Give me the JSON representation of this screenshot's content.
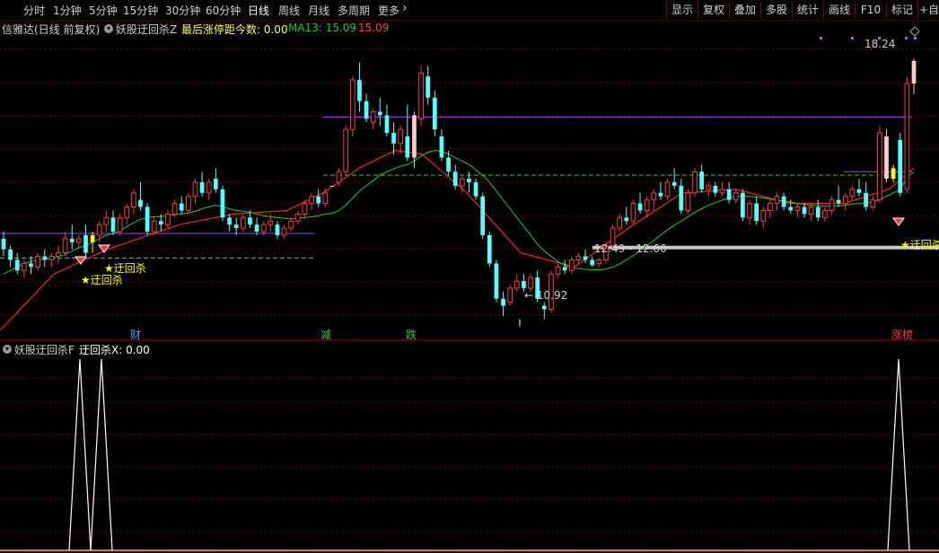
{
  "toolbar": {
    "periods": [
      "分时",
      "1分钟",
      "5分钟",
      "15分钟",
      "30分钟",
      "60分钟",
      "日线",
      "周线",
      "月线",
      "多周期",
      "更多"
    ],
    "active_period": "日线",
    "more_arrow": "›",
    "buttons": [
      "显示",
      "复权",
      "叠加",
      "多股",
      "统计",
      "画线",
      "F10",
      "标记",
      "+自选"
    ]
  },
  "main_panel": {
    "stock_label": "信雅达(日线 前复权)",
    "indicator_name": "妖股迂回杀Z",
    "stat_label": "最后涨停距今数: 0.00",
    "ma_label": "MA13: 15.09",
    "ma_value2": "15.09",
    "price_high_label": "18.24",
    "price_low_label": "10.92",
    "range_label": "12.49 - 12.66",
    "signal_texts": [
      "迂回杀",
      "迂回杀",
      "迂回杀"
    ],
    "bottom_markers": [
      "财",
      "减",
      "跌",
      "涨榜"
    ]
  },
  "sub_panel": {
    "indicator_name": "妖股迂回杀F",
    "value_label": "迂回杀X: 0.00"
  },
  "colors": {
    "up": "#ff3b3b",
    "down": "#54ffff",
    "ma13": "#22cc22",
    "trend": "#ff2020",
    "support": "#ffff00",
    "grid": "#8b0000",
    "purple": "#9b40ff",
    "green_dash": "#33cc33",
    "pink_bar": "#ffcccc",
    "yellow_bar": "#ffff00"
  },
  "chart_data": {
    "type": "candlestick",
    "price_range": [
      10.5,
      19.0
    ],
    "ohlc": [
      [
        13.2,
        13.4,
        12.7,
        12.9
      ],
      [
        12.9,
        13.0,
        12.4,
        12.6
      ],
      [
        12.6,
        12.8,
        12.2,
        12.3
      ],
      [
        12.3,
        12.6,
        12.1,
        12.5
      ],
      [
        12.5,
        12.7,
        12.2,
        12.4
      ],
      [
        12.4,
        12.8,
        12.3,
        12.7
      ],
      [
        12.7,
        12.9,
        12.4,
        12.6
      ],
      [
        12.6,
        12.8,
        12.4,
        12.7
      ],
      [
        12.7,
        13.0,
        12.5,
        12.8
      ],
      [
        12.8,
        13.4,
        12.7,
        13.2
      ],
      [
        13.2,
        13.6,
        12.9,
        13.1
      ],
      [
        13.1,
        13.3,
        12.9,
        13.2
      ],
      [
        13.3,
        13.6,
        12.7,
        12.8
      ],
      [
        13.1,
        13.4,
        12.8,
        13.3
      ],
      [
        13.3,
        13.7,
        13.1,
        13.6
      ],
      [
        13.6,
        14.0,
        13.4,
        13.8
      ],
      [
        13.8,
        14.0,
        13.3,
        13.4
      ],
      [
        13.4,
        13.9,
        13.3,
        13.8
      ],
      [
        13.8,
        14.2,
        13.6,
        14.1
      ],
      [
        14.1,
        14.6,
        13.9,
        14.5
      ],
      [
        14.3,
        14.8,
        14.0,
        14.1
      ],
      [
        14.1,
        14.2,
        13.3,
        13.4
      ],
      [
        13.4,
        13.8,
        13.3,
        13.7
      ],
      [
        13.7,
        13.9,
        13.4,
        13.6
      ],
      [
        13.6,
        14.0,
        13.5,
        13.9
      ],
      [
        13.9,
        14.3,
        13.8,
        14.2
      ],
      [
        14.2,
        14.4,
        13.9,
        14.0
      ],
      [
        14.0,
        14.5,
        13.9,
        14.4
      ],
      [
        14.4,
        14.9,
        14.2,
        14.8
      ],
      [
        14.8,
        15.1,
        14.4,
        14.5
      ],
      [
        14.5,
        14.9,
        14.3,
        14.8
      ],
      [
        14.9,
        15.2,
        14.5,
        14.6
      ],
      [
        14.6,
        14.7,
        13.7,
        13.8
      ],
      [
        13.8,
        13.9,
        13.4,
        13.6
      ],
      [
        13.6,
        13.8,
        13.3,
        13.5
      ],
      [
        13.5,
        13.9,
        13.4,
        13.8
      ],
      [
        13.8,
        14.0,
        13.5,
        13.6
      ],
      [
        13.6,
        13.8,
        13.3,
        13.4
      ],
      [
        13.4,
        13.7,
        13.3,
        13.6
      ],
      [
        13.6,
        13.9,
        13.4,
        13.7
      ],
      [
        13.6,
        13.7,
        13.2,
        13.3
      ],
      [
        13.3,
        13.6,
        13.2,
        13.5
      ],
      [
        13.5,
        13.8,
        13.4,
        13.7
      ],
      [
        13.7,
        14.0,
        13.6,
        13.9
      ],
      [
        13.9,
        14.3,
        13.8,
        14.2
      ],
      [
        14.2,
        14.5,
        14.0,
        14.4
      ],
      [
        14.4,
        14.6,
        14.1,
        14.2
      ],
      [
        14.2,
        14.6,
        14.1,
        14.5
      ],
      [
        14.7,
        14.7,
        14.7,
        14.7
      ],
      [
        14.8,
        15.2,
        14.7,
        15.1
      ],
      [
        15.1,
        16.4,
        15.0,
        16.3
      ],
      [
        16.3,
        17.8,
        16.1,
        17.7
      ],
      [
        17.7,
        18.2,
        16.8,
        17.1
      ],
      [
        17.1,
        17.3,
        16.5,
        16.6
      ],
      [
        16.5,
        16.9,
        16.3,
        16.8
      ],
      [
        16.8,
        17.2,
        16.4,
        16.7
      ],
      [
        16.7,
        17.0,
        16.1,
        16.2
      ],
      [
        16.2,
        16.5,
        15.6,
        15.9
      ],
      [
        15.9,
        16.4,
        15.6,
        16.3
      ],
      [
        16.1,
        17.0,
        15.4,
        15.5
      ],
      [
        15.5,
        16.8,
        15.2,
        16.7
      ],
      [
        16.6,
        18.1,
        16.4,
        17.9
      ],
      [
        17.8,
        18.1,
        17.0,
        17.2
      ],
      [
        17.2,
        17.4,
        16.1,
        16.3
      ],
      [
        16.1,
        16.3,
        15.4,
        15.5
      ],
      [
        15.5,
        15.7,
        15.0,
        15.1
      ],
      [
        15.1,
        15.3,
        14.6,
        14.7
      ],
      [
        14.7,
        15.0,
        14.5,
        14.9
      ],
      [
        14.9,
        15.1,
        14.5,
        14.8
      ],
      [
        14.8,
        14.9,
        14.3,
        14.4
      ],
      [
        14.4,
        14.5,
        13.2,
        13.3
      ],
      [
        13.3,
        13.4,
        12.4,
        12.5
      ],
      [
        12.5,
        12.6,
        11.4,
        11.5
      ],
      [
        11.5,
        11.7,
        11.0,
        11.3
      ],
      [
        11.4,
        11.9,
        11.3,
        11.8
      ],
      [
        11.8,
        12.2,
        11.7,
        12.0
      ],
      [
        12.0,
        12.2,
        11.7,
        11.8
      ],
      [
        11.8,
        12.2,
        11.7,
        12.1
      ],
      [
        12.1,
        12.3,
        11.4,
        11.5
      ],
      [
        11.3,
        11.4,
        10.92,
        11.2
      ],
      [
        11.2,
        12.3,
        11.1,
        12.2
      ],
      [
        12.2,
        12.5,
        12.1,
        12.4
      ],
      [
        12.4,
        12.6,
        12.2,
        12.3
      ],
      [
        12.3,
        12.7,
        12.2,
        12.6
      ],
      [
        12.6,
        12.8,
        12.5,
        12.7
      ],
      [
        12.7,
        12.9,
        12.5,
        12.6
      ],
      [
        12.6,
        12.7,
        12.4,
        12.45
      ],
      [
        12.49,
        12.66,
        12.4,
        12.6
      ],
      [
        12.6,
        13.1,
        12.5,
        13.0
      ],
      [
        13.0,
        13.6,
        12.9,
        13.5
      ],
      [
        13.5,
        13.9,
        13.4,
        13.8
      ],
      [
        13.8,
        14.1,
        13.6,
        13.7
      ],
      [
        13.7,
        14.3,
        13.6,
        14.2
      ],
      [
        14.2,
        14.5,
        13.9,
        14.0
      ],
      [
        14.0,
        14.4,
        13.8,
        14.3
      ],
      [
        14.3,
        14.6,
        14.0,
        14.5
      ],
      [
        14.5,
        14.8,
        14.3,
        14.4
      ],
      [
        14.4,
        14.9,
        14.3,
        14.8
      ],
      [
        14.8,
        15.2,
        14.6,
        14.7
      ],
      [
        14.7,
        14.9,
        13.9,
        14.0
      ],
      [
        14.0,
        14.6,
        13.9,
        14.5
      ],
      [
        14.5,
        15.2,
        14.4,
        15.1
      ],
      [
        15.1,
        15.3,
        14.5,
        14.6
      ],
      [
        14.6,
        14.8,
        14.4,
        14.7
      ],
      [
        14.7,
        14.8,
        14.4,
        14.5
      ],
      [
        14.5,
        14.8,
        14.4,
        14.6
      ],
      [
        14.6,
        14.8,
        14.2,
        14.3
      ],
      [
        14.3,
        14.6,
        14.2,
        14.5
      ],
      [
        14.5,
        14.6,
        13.7,
        13.8
      ],
      [
        13.8,
        14.3,
        13.6,
        14.2
      ],
      [
        14.2,
        14.4,
        13.6,
        13.7
      ],
      [
        13.7,
        14.1,
        13.5,
        14.0
      ],
      [
        14.0,
        14.3,
        13.8,
        14.2
      ],
      [
        14.2,
        14.5,
        14.0,
        14.4
      ],
      [
        14.4,
        14.5,
        14.0,
        14.1
      ],
      [
        14.1,
        14.3,
        13.9,
        14.0
      ],
      [
        14.0,
        14.2,
        13.8,
        14.1
      ],
      [
        14.1,
        14.2,
        13.8,
        13.9
      ],
      [
        13.9,
        14.2,
        13.7,
        14.1
      ],
      [
        14.1,
        14.3,
        13.7,
        13.8
      ],
      [
        13.8,
        14.1,
        13.7,
        14.0
      ],
      [
        14.0,
        14.4,
        13.9,
        14.3
      ],
      [
        14.3,
        14.7,
        14.1,
        14.2
      ],
      [
        14.2,
        14.5,
        14.0,
        14.4
      ],
      [
        14.4,
        14.7,
        14.3,
        14.6
      ],
      [
        14.6,
        14.9,
        14.4,
        14.5
      ],
      [
        14.5,
        14.8,
        14.0,
        14.1
      ],
      [
        14.1,
        14.4,
        14.0,
        14.3
      ],
      [
        14.3,
        16.4,
        14.2,
        16.2
      ],
      [
        16.1,
        16.3,
        14.8,
        14.9
      ],
      [
        14.9,
        15.3,
        14.8,
        15.2
      ],
      [
        16.0,
        16.2,
        14.4,
        14.5
      ],
      [
        14.6,
        17.8,
        14.5,
        17.6
      ],
      [
        17.6,
        18.3,
        17.3,
        18.24
      ]
    ],
    "ma13": [
      12.2,
      12.3,
      12.4,
      12.5,
      12.55,
      12.6,
      12.62,
      12.65,
      12.7,
      12.75,
      12.85,
      12.95,
      13.0,
      13.1,
      13.2,
      13.3,
      13.35,
      13.42,
      13.55,
      13.65,
      13.75,
      13.8,
      13.82,
      13.83,
      13.85,
      13.88,
      13.9,
      13.93,
      13.98,
      14.05,
      14.1,
      14.15,
      14.1,
      14.05,
      14.0,
      13.98,
      13.95,
      13.9,
      13.85,
      13.82,
      13.8,
      13.78,
      13.76,
      13.78,
      13.8,
      13.82,
      13.85,
      13.9,
      13.92,
      14.0,
      14.15,
      14.35,
      14.55,
      14.7,
      14.85,
      15.0,
      15.1,
      15.18,
      15.26,
      15.3,
      15.4,
      15.55,
      15.65,
      15.7,
      15.68,
      15.6,
      15.5,
      15.4,
      15.3,
      15.15,
      15.0,
      14.8,
      14.55,
      14.3,
      14.05,
      13.8,
      13.55,
      13.3,
      13.05,
      12.85,
      12.7,
      12.55,
      12.45,
      12.38,
      12.35,
      12.33,
      12.32,
      12.32,
      12.34,
      12.4,
      12.48,
      12.6,
      12.72,
      12.86,
      13.0,
      13.15,
      13.3,
      13.45,
      13.58,
      13.7,
      13.82,
      13.95,
      14.05,
      14.15,
      14.22,
      14.3,
      14.35,
      14.4,
      14.4,
      14.4,
      14.38,
      14.36,
      14.32,
      14.3,
      14.26,
      14.24,
      14.2,
      14.18,
      14.15,
      14.14,
      14.12,
      14.12,
      14.13,
      14.15,
      14.18,
      14.2,
      14.22,
      14.24,
      14.3,
      14.4,
      14.5,
      14.6,
      14.95,
      15.09
    ]
  }
}
